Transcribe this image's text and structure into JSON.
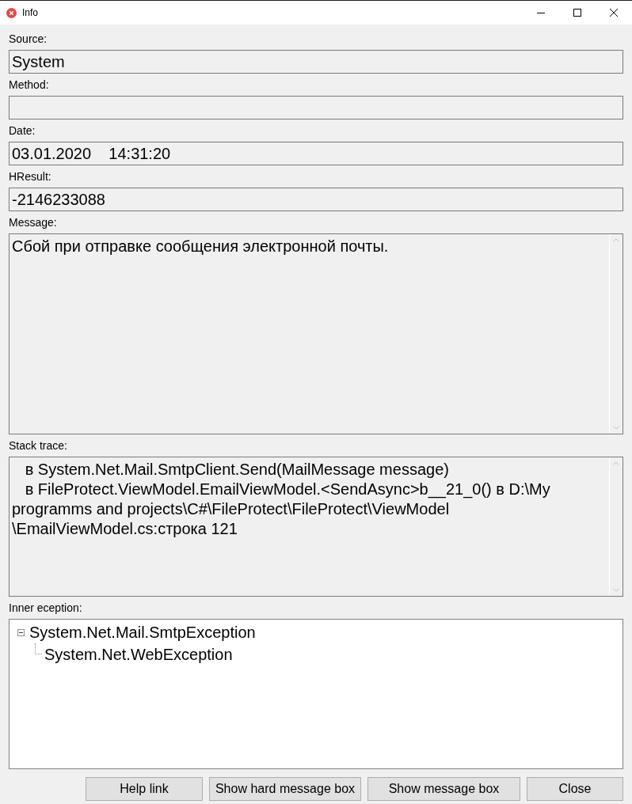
{
  "window": {
    "title": "Info"
  },
  "fields": [
    {
      "label": "Source:",
      "value": "System"
    },
    {
      "label": "Method:"
    },
    {
      "label": "Date:",
      "value": "03.01.2020    14:31:20"
    },
    {
      "label": "HResult:",
      "value": "-2146233088"
    }
  ],
  "message": {
    "label": "Message:",
    "text": "Сбой при отправке сообщения электронной почты."
  },
  "stack_trace": {
    "label": "Stack trace:",
    "lines": [
      "   в System.Net.Mail.SmtpClient.Send(MailMessage message)",
      "   в FileProtect.ViewModel.EmailViewModel.<SendAsync>b__21_0() в D:\\My",
      "programms and projects\\C#\\FileProtect\\FileProtect\\ViewModel",
      "\\EmailViewModel.cs:строка 121"
    ]
  },
  "inner_exception": {
    "label": "Inner eception:",
    "tree": [
      {
        "text": "System.Net.Mail.SmtpException",
        "expanded": true,
        "children": [
          {
            "text": "System.Net.WebException"
          }
        ]
      }
    ]
  },
  "buttons": [
    "Help link",
    "Show hard message box",
    "Show message box",
    "Close"
  ]
}
